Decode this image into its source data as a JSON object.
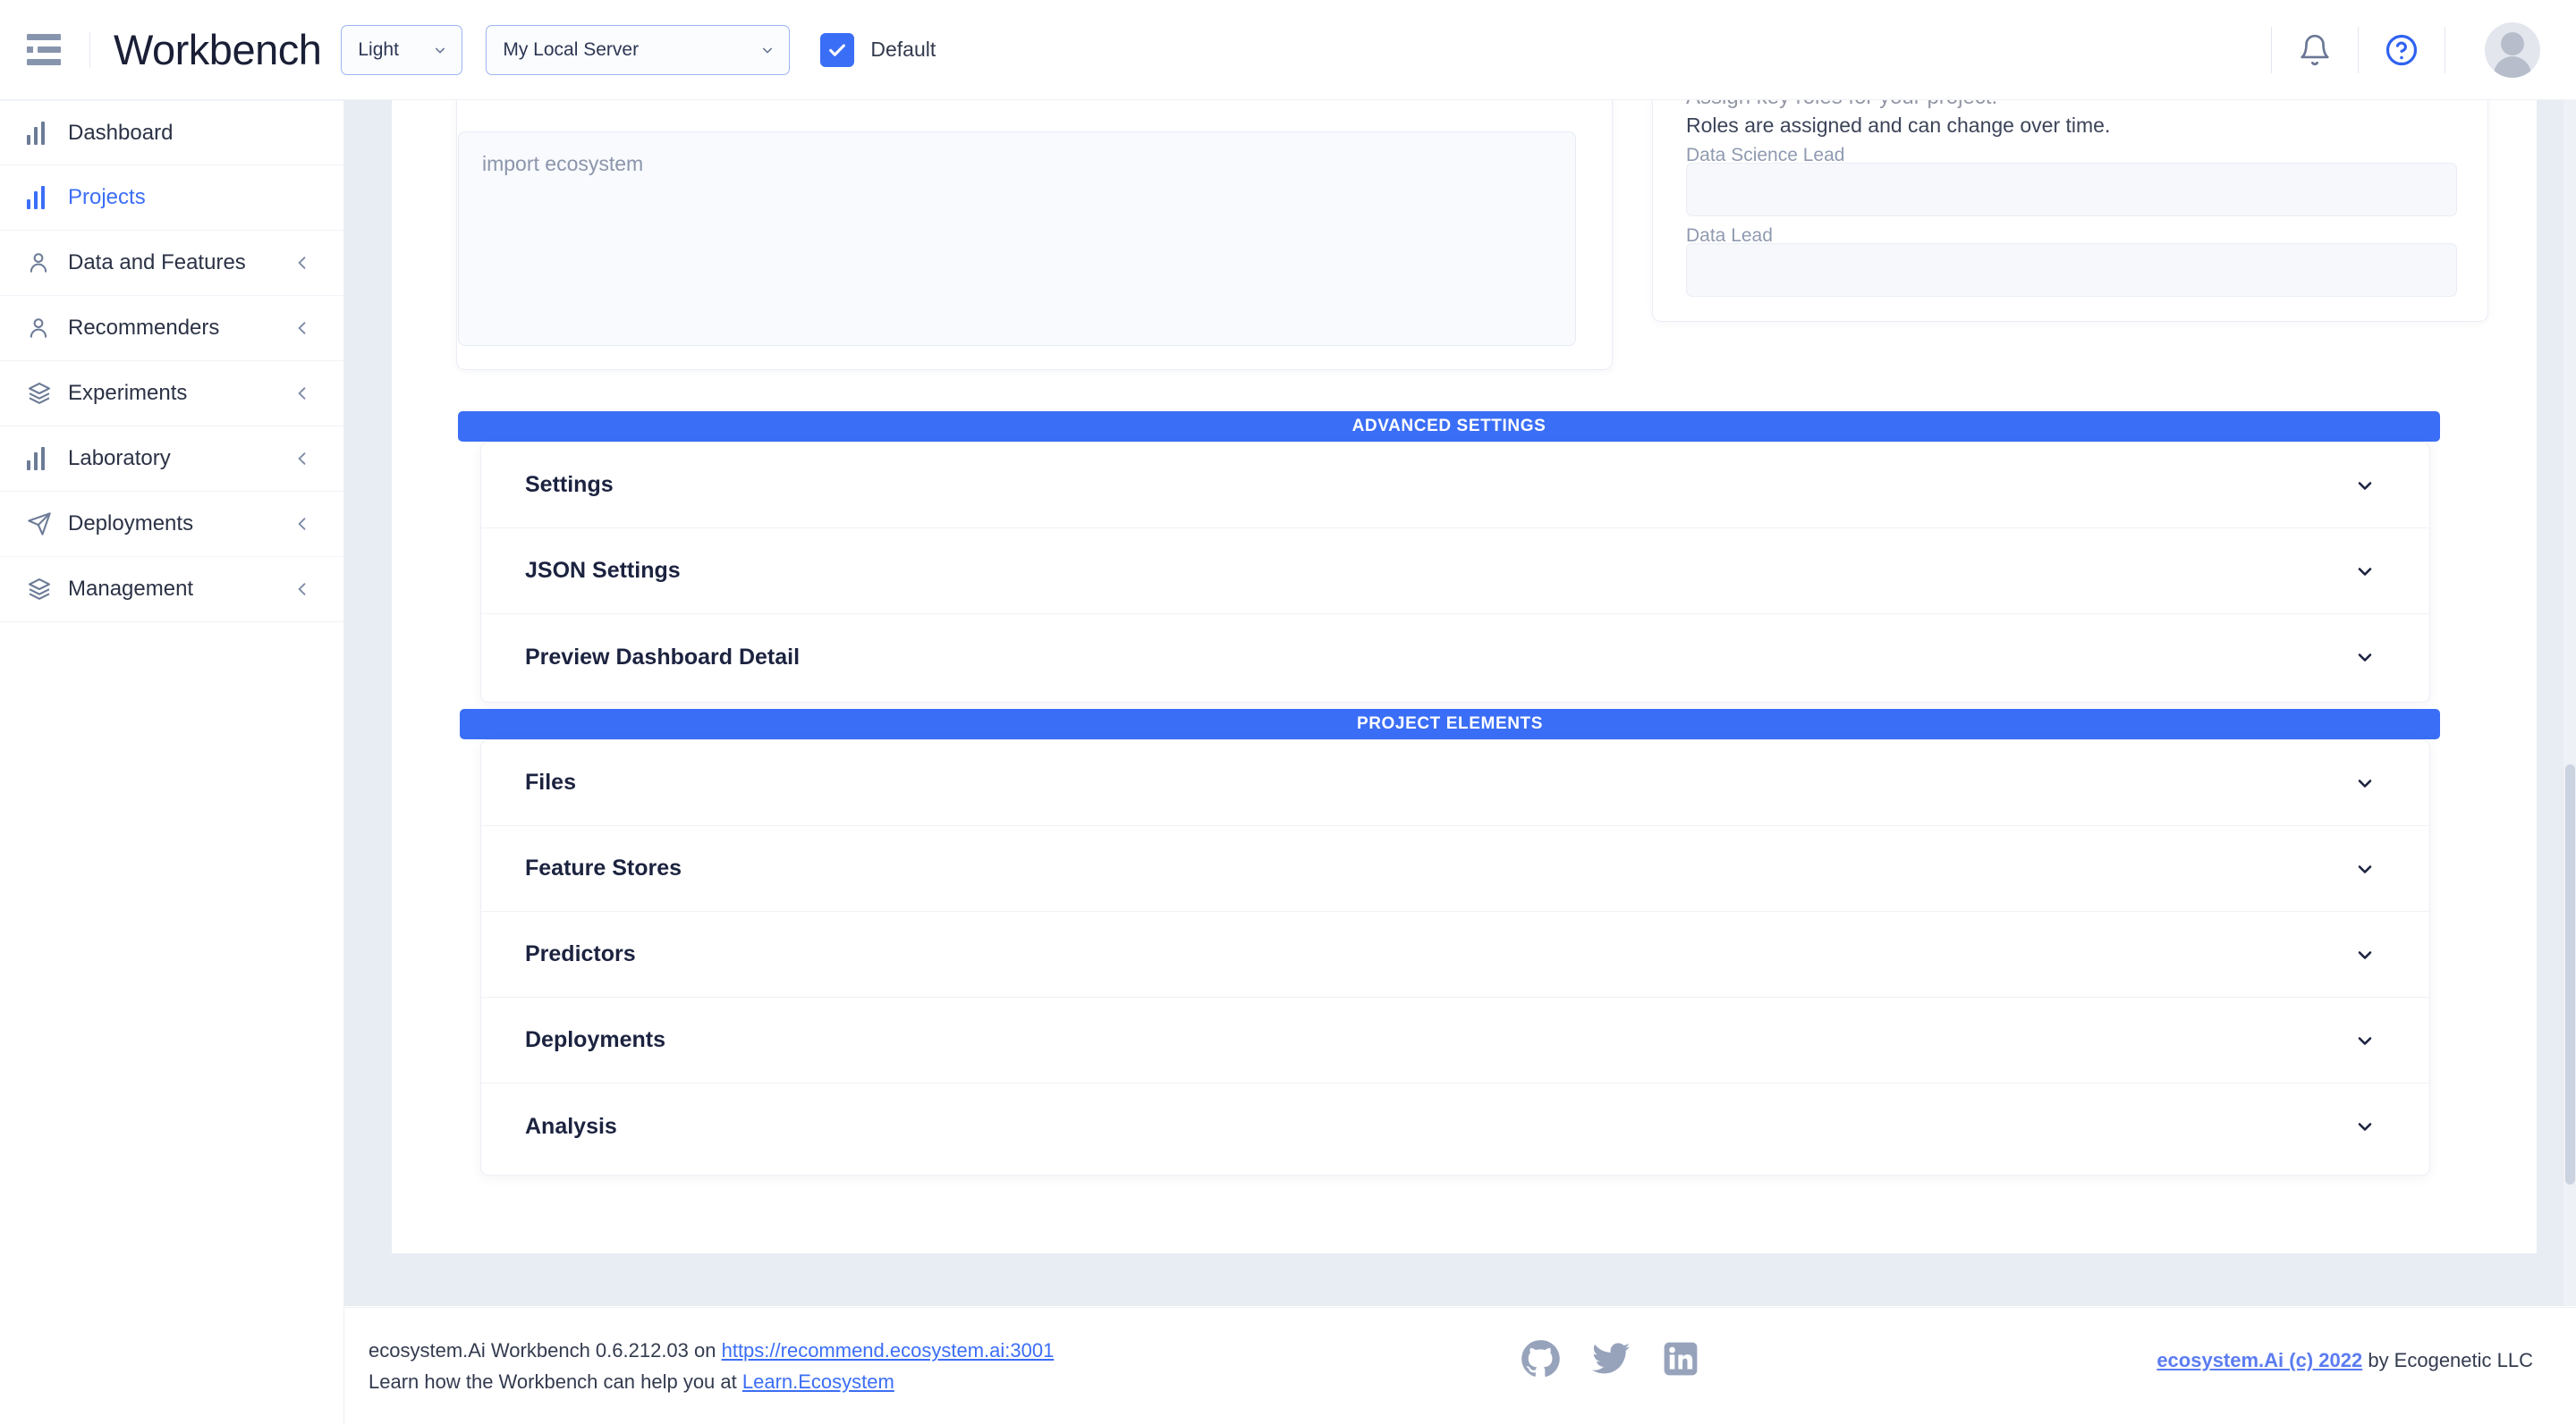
{
  "header": {
    "menu_icon": "hamburger-icon",
    "brand": "Workbench",
    "theme_select": {
      "value": "Light",
      "icon": "chevron-down-icon"
    },
    "server_select": {
      "value": "My Local Server",
      "icon": "chevron-down-icon"
    },
    "default_checkbox": {
      "label": "Default",
      "checked": true,
      "color": "#3b6ef6"
    },
    "notifications_icon": "bell-icon",
    "help_icon": "help-circle-icon",
    "avatar": "user-avatar"
  },
  "sidebar": {
    "items": [
      {
        "label": "Dashboard",
        "icon": "bar-chart-icon",
        "active": false,
        "expandable": false
      },
      {
        "label": "Projects",
        "icon": "bar-chart-icon",
        "active": true,
        "expandable": false
      },
      {
        "label": "Data and Features",
        "icon": "user-icon",
        "active": false,
        "expandable": true
      },
      {
        "label": "Recommenders",
        "icon": "user-icon",
        "active": false,
        "expandable": true
      },
      {
        "label": "Experiments",
        "icon": "layers-icon",
        "active": false,
        "expandable": true
      },
      {
        "label": "Laboratory",
        "icon": "bar-chart-icon",
        "active": false,
        "expandable": true
      },
      {
        "label": "Deployments",
        "icon": "send-icon",
        "active": false,
        "expandable": true
      },
      {
        "label": "Management",
        "icon": "layers-icon",
        "active": false,
        "expandable": true
      }
    ]
  },
  "main": {
    "code_editor": {
      "placeholder": "import ecosystem",
      "value": ""
    },
    "roles_panel": {
      "title": "Assign key roles for your project.",
      "subtitle": "Roles are assigned and can change over time.",
      "fields": [
        {
          "label": "Data Science Lead",
          "value": ""
        },
        {
          "label": "Data Lead",
          "value": ""
        }
      ]
    },
    "sections": [
      {
        "banner": "ADVANCED SETTINGS",
        "rows": [
          {
            "label": "Settings",
            "icon": "chevron-down-icon"
          },
          {
            "label": "JSON Settings",
            "icon": "chevron-down-icon"
          },
          {
            "label": "Preview Dashboard Detail",
            "icon": "chevron-down-icon"
          }
        ]
      },
      {
        "banner": "PROJECT ELEMENTS",
        "rows": [
          {
            "label": "Files",
            "icon": "chevron-down-icon"
          },
          {
            "label": "Feature Stores",
            "icon": "chevron-down-icon"
          },
          {
            "label": "Predictors",
            "icon": "chevron-down-icon"
          },
          {
            "label": "Deployments",
            "icon": "chevron-down-icon"
          },
          {
            "label": "Analysis",
            "icon": "chevron-down-icon"
          }
        ]
      }
    ]
  },
  "footer": {
    "line1_prefix": "ecosystem.Ai Workbench 0.6.212.03 on ",
    "line1_link": "https://recommend.ecosystem.ai:3001",
    "line2_prefix": "Learn how the Workbench can help you at ",
    "line2_link": "Learn.Ecosystem",
    "social": [
      "github-icon",
      "twitter-icon",
      "linkedin-icon"
    ],
    "copyright_link": "ecosystem.Ai (c) 2022",
    "copyright_rest": " by Ecogenetic LLC"
  },
  "theme": {
    "accent": "#3b6ef6",
    "page_bg": "#e8ecf3",
    "text_dark": "#1c2340",
    "muted": "#8f9ab0"
  }
}
